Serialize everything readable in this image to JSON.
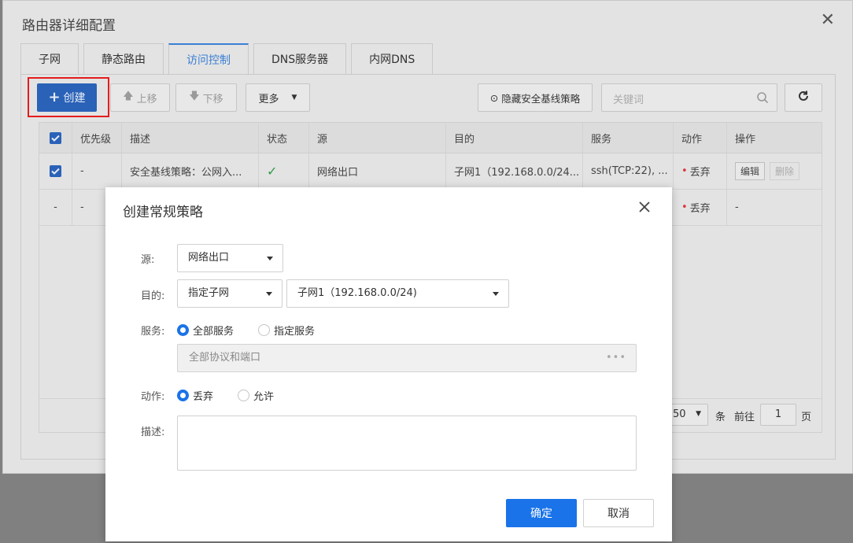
{
  "outer": {
    "title": "路由器详细配置",
    "tabs": [
      "子网",
      "静态路由",
      "访问控制",
      "DNS服务器",
      "内网DNS"
    ],
    "toolbar": {
      "create": "创建",
      "up": "上移",
      "down": "下移",
      "more": "更多",
      "hide_baseline": "隐藏安全基线策略",
      "search_placeholder": "关键词"
    },
    "table": {
      "headers": [
        "优先级",
        "描述",
        "状态",
        "源",
        "目的",
        "服务",
        "动作",
        "操作"
      ],
      "rows": [
        {
          "priority": "-",
          "desc": "安全基线策略：公网入...",
          "status": "✓",
          "source": "网络出口",
          "dest": "子网1（192.168.0.0/24...",
          "service": "ssh(TCP:22), ...",
          "action": "丢弃",
          "op_edit": "编辑",
          "op_delete": "删除"
        },
        {
          "check": "-",
          "priority": "-",
          "action": "丢弃",
          "op": "-"
        }
      ]
    },
    "pager": {
      "size": "50",
      "unit": "条",
      "goto": "前往",
      "page": "1",
      "page_unit": "页"
    }
  },
  "modal": {
    "title": "创建常规策略",
    "source_label": "源:",
    "source_value": "网络出口",
    "dest_label": "目的:",
    "dest_type": "指定子网",
    "dest_value": "子网1（192.168.0.0/24)",
    "service_label": "服务:",
    "service_all": "全部服务",
    "service_specific": "指定服务",
    "service_field": "全部协议和端口",
    "service_dots": "•••",
    "action_label": "动作:",
    "action_drop": "丢弃",
    "action_allow": "允许",
    "desc_label": "描述:",
    "ok": "确定",
    "cancel": "取消"
  },
  "colors": {
    "primary": "#1a73e8",
    "create_button": "#2a62b8",
    "highlight": "#e41d1d",
    "status_ok": "#2e9a4a",
    "drop_dot": "#d9363e"
  }
}
